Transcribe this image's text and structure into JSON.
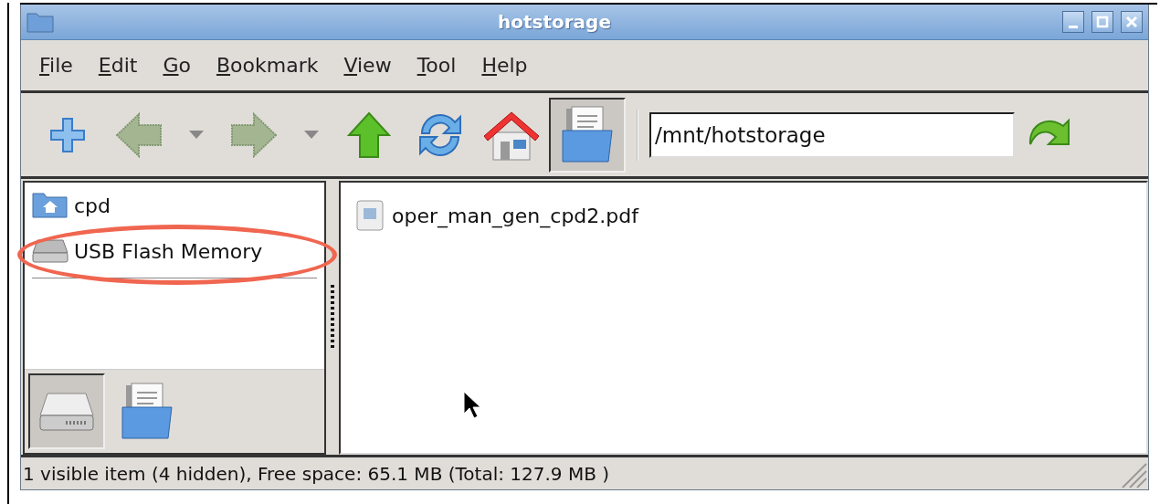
{
  "window": {
    "title": "hotstorage",
    "controls": [
      {
        "kind": "minimize"
      },
      {
        "kind": "maximize"
      },
      {
        "kind": "close"
      }
    ]
  },
  "menu": [
    {
      "label": "File"
    },
    {
      "label": "Edit"
    },
    {
      "label": "Go"
    },
    {
      "label": "Bookmark"
    },
    {
      "label": "View"
    },
    {
      "label": "Tool"
    },
    {
      "label": "Help"
    }
  ],
  "toolbar": [
    {
      "kind": "new-tab",
      "disabled": false,
      "pressed": false
    },
    {
      "kind": "back",
      "disabled": true,
      "pressed": false
    },
    {
      "kind": "dropdown",
      "disabled": false,
      "pressed": false
    },
    {
      "kind": "forward",
      "disabled": true,
      "pressed": false
    },
    {
      "kind": "dropdown",
      "disabled": false,
      "pressed": false
    },
    {
      "kind": "up",
      "disabled": false,
      "pressed": false
    },
    {
      "kind": "reload",
      "disabled": false,
      "pressed": false
    },
    {
      "kind": "home",
      "disabled": false,
      "pressed": false
    },
    {
      "kind": "folder-view",
      "disabled": false,
      "pressed": true
    }
  ],
  "location": {
    "value": "/mnt/hotstorage"
  },
  "sidebar": {
    "items": [
      {
        "label": "cpd",
        "kind": "home-folder",
        "highlighted": false
      },
      {
        "label": "USB Flash Memory",
        "kind": "drive",
        "highlighted": true
      }
    ],
    "tabs": [
      {
        "kind": "places",
        "selected": true
      },
      {
        "kind": "tree",
        "selected": false
      }
    ]
  },
  "files": [
    {
      "name": "oper_man_gen_cpd2.pdf"
    }
  ],
  "status_bar": {
    "text": "1 visible item (4 hidden), Free space: 65.1 MB (Total: 127.9 MB )"
  }
}
